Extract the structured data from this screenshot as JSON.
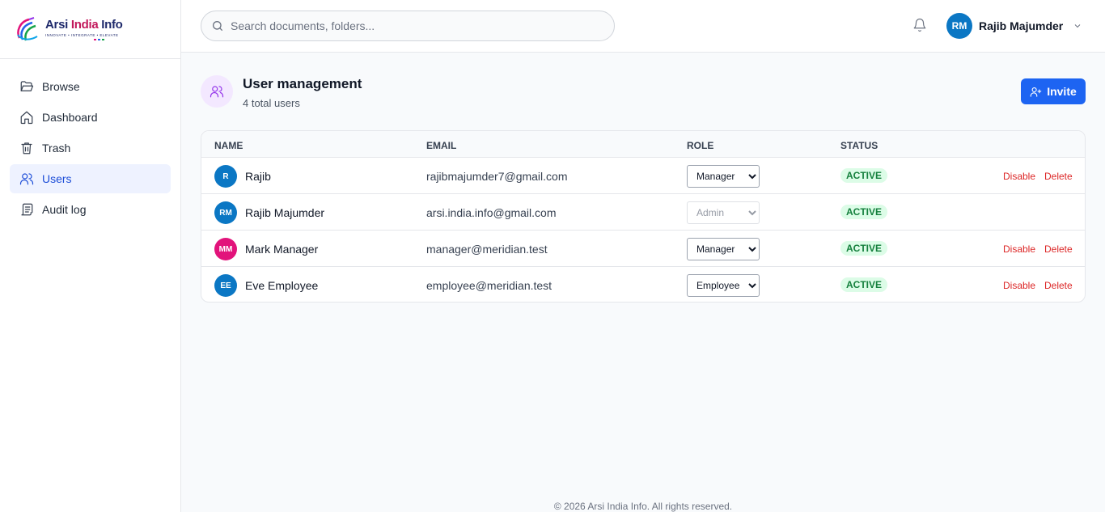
{
  "brand": {
    "title_part1": "Arsi ",
    "title_part2": "India",
    "title_part3": " Info",
    "tagline": "INNOVATE • INTEGRATE • ELEVATE"
  },
  "sidebar": {
    "items": [
      {
        "label": "Browse",
        "icon": "folder-open-icon"
      },
      {
        "label": "Dashboard",
        "icon": "home-icon"
      },
      {
        "label": "Trash",
        "icon": "trash-icon"
      },
      {
        "label": "Users",
        "icon": "users-icon",
        "active": true
      },
      {
        "label": "Audit log",
        "icon": "scroll-icon"
      }
    ]
  },
  "topbar": {
    "search_placeholder": "Search documents, folders...",
    "user_initials": "RM",
    "user_name": "Rajib Majumder"
  },
  "page": {
    "title": "User management",
    "subtitle": "4 total users",
    "invite_label": "Invite"
  },
  "table": {
    "headers": {
      "name": "NAME",
      "email": "EMAIL",
      "role": "ROLE",
      "status": "STATUS"
    },
    "rows": [
      {
        "initials": "R",
        "name": "Rajib",
        "email": "rajibmajumder7@gmail.com",
        "role": "Manager",
        "status": "ACTIVE",
        "disable": "Disable",
        "delete": "Delete",
        "avatar_color": "#0b77c4"
      },
      {
        "initials": "RM",
        "name": "Rajib Majumder",
        "email": "arsi.india.info@gmail.com",
        "role": "Admin",
        "status": "ACTIVE",
        "disable": "",
        "delete": "",
        "avatar_color": "#0b77c4"
      },
      {
        "initials": "MM",
        "name": "Mark Manager",
        "email": "manager@meridian.test",
        "role": "Manager",
        "status": "ACTIVE",
        "disable": "Disable",
        "delete": "Delete",
        "avatar_color": "#e2137b"
      },
      {
        "initials": "EE",
        "name": "Eve Employee",
        "email": "employee@meridian.test",
        "role": "Employee",
        "status": "ACTIVE",
        "disable": "Disable",
        "delete": "Delete",
        "avatar_color": "#0b77c4"
      }
    ]
  },
  "footer": {
    "text": "© 2026 Arsi India Info. All rights reserved."
  },
  "colors": {
    "accent": "#1d64f2",
    "active_badge_bg": "#dcfce7",
    "active_badge_text": "#15803d",
    "danger": "#dc2626"
  }
}
